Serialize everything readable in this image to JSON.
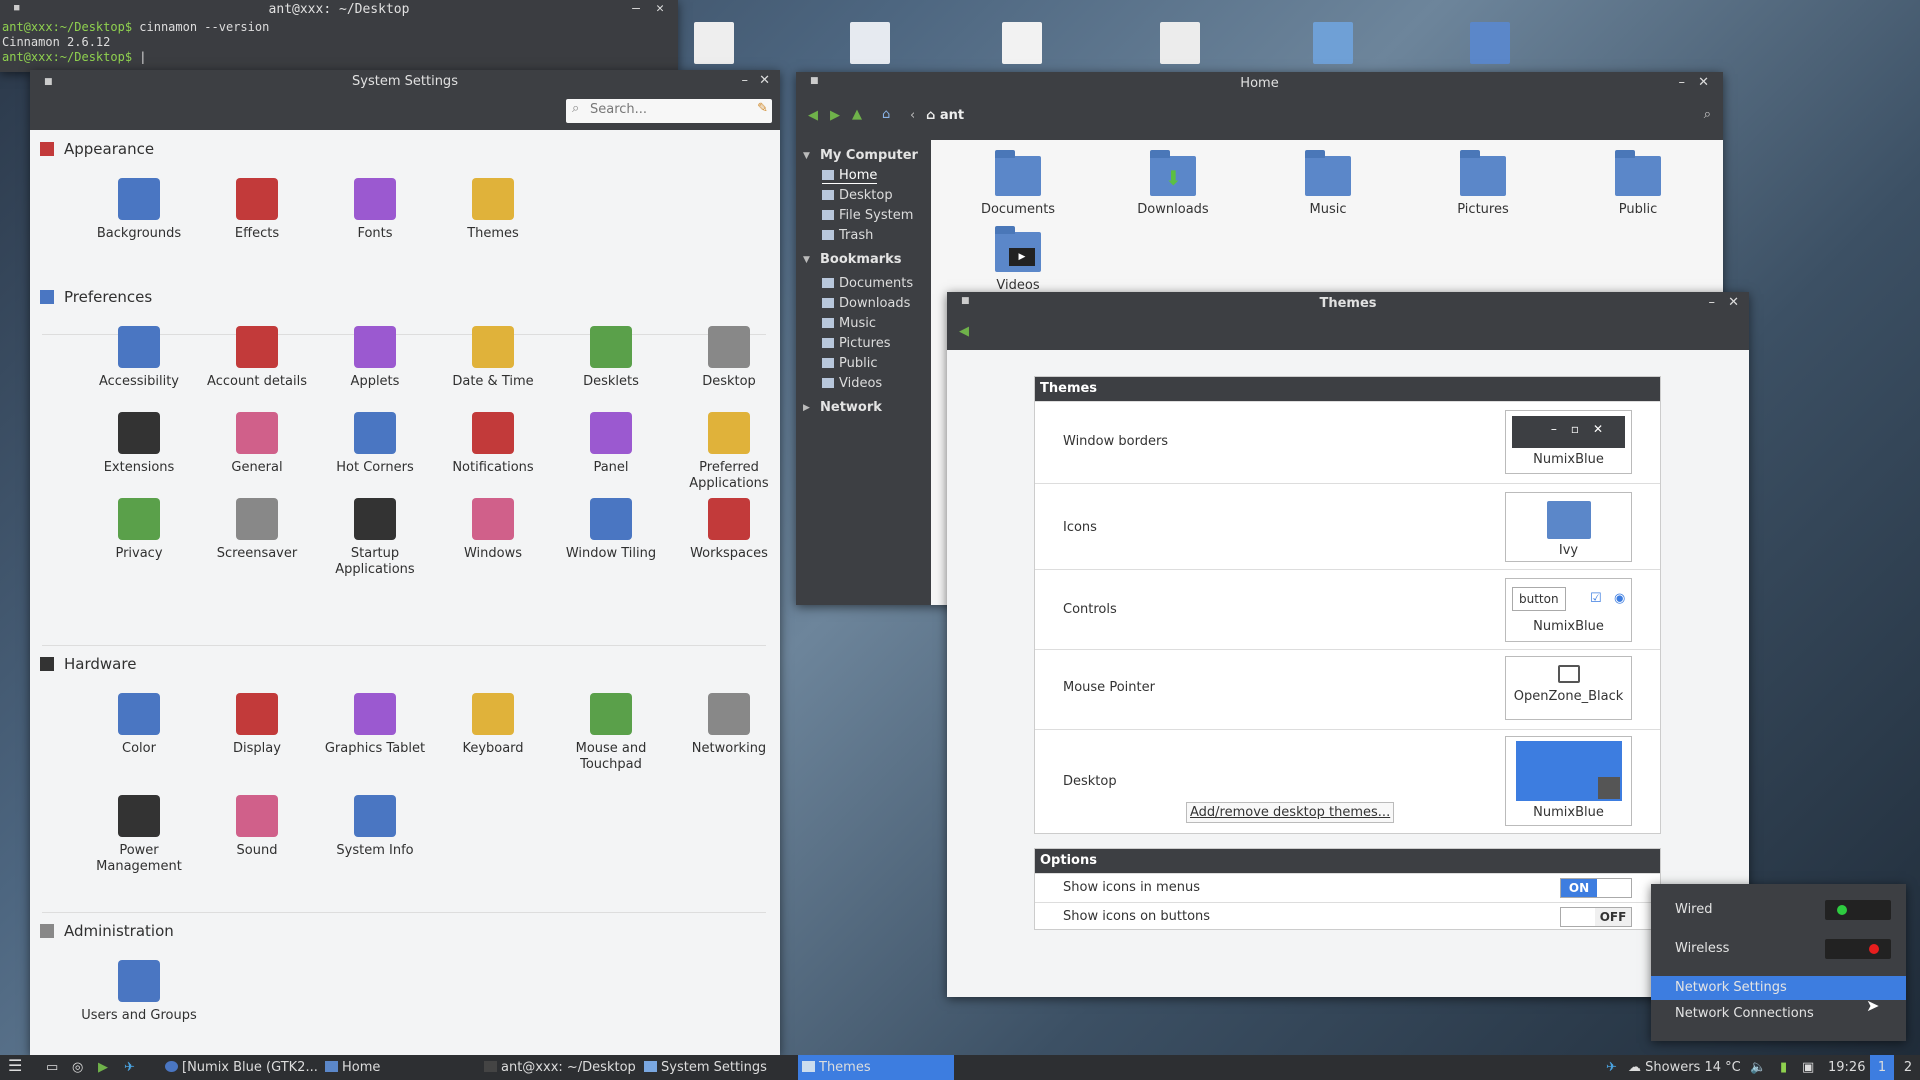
{
  "terminal": {
    "title": "ant@xxx: ~/Desktop",
    "lines": [
      {
        "prompt": "ant@xxx:~/Desktop$",
        "cmd": " cinnamon --version"
      },
      {
        "prompt": "",
        "cmd": "Cinnamon 2.6.12"
      },
      {
        "prompt": "ant@xxx:~/Desktop$",
        "cmd": " |"
      }
    ]
  },
  "settings": {
    "title": "System Settings",
    "search_placeholder": "Search...",
    "sections": {
      "appearance": "Appearance",
      "preferences": "Preferences",
      "hardware": "Hardware",
      "administration": "Administration"
    },
    "appearance": [
      "Backgrounds",
      "Effects",
      "Fonts",
      "Themes"
    ],
    "preferences": [
      "Accessibility",
      "Account details",
      "Applets",
      "Date & Time",
      "Desklets",
      "Desktop",
      "Extensions",
      "General",
      "Hot Corners",
      "Notifications",
      "Panel",
      "Preferred Applications",
      "Privacy",
      "Screensaver",
      "Startup Applications",
      "Windows",
      "Window Tiling",
      "Workspaces"
    ],
    "hardware": [
      "Color",
      "Display",
      "Graphics Tablet",
      "Keyboard",
      "Mouse and Touchpad",
      "Networking",
      "Power Management",
      "Sound",
      "System Info"
    ],
    "administration": [
      "Users and Groups"
    ]
  },
  "files": {
    "title": "Home",
    "location": "ant",
    "side": {
      "my_computer": "My Computer",
      "bookmarks": "Bookmarks",
      "network": "Network",
      "computer_items": [
        "Home",
        "Desktop",
        "File System",
        "Trash"
      ],
      "bookmark_items": [
        "Documents",
        "Downloads",
        "Music",
        "Pictures",
        "Public",
        "Videos"
      ]
    },
    "folders": [
      "Documents",
      "Downloads",
      "Music",
      "Pictures",
      "Public",
      "Videos"
    ]
  },
  "themes": {
    "title": "Themes",
    "group": "Themes",
    "rows": [
      {
        "label": "Window borders",
        "value": "NumixBlue"
      },
      {
        "label": "Icons",
        "value": "Ivy"
      },
      {
        "label": "Controls",
        "value": "NumixBlue",
        "button": "button"
      },
      {
        "label": "Mouse Pointer",
        "value": "OpenZone_Black"
      },
      {
        "label": "Desktop",
        "value": "NumixBlue",
        "link": "Add/remove desktop themes..."
      }
    ],
    "options_title": "Options",
    "options": [
      {
        "label": "Show icons in menus",
        "state": "ON"
      },
      {
        "label": "Show icons on buttons",
        "state": "OFF"
      }
    ]
  },
  "network_popup": {
    "wired": "Wired",
    "wireless": "Wireless",
    "settings": "Network Settings",
    "connections": "Network Connections",
    "wired_color": "#2ecc40",
    "wireless_color": "#e81e1e"
  },
  "taskbar": {
    "items": [
      "[Numix Blue (GTK2...",
      "Home",
      "ant@xxx: ~/Desktop",
      "System Settings",
      "Themes"
    ],
    "weather": "Showers 14 °C",
    "clock": "19:26",
    "ws1": "1",
    "ws2": "2"
  },
  "colors": {
    "accent": "#3d7de0",
    "header": "#3d3f43"
  }
}
